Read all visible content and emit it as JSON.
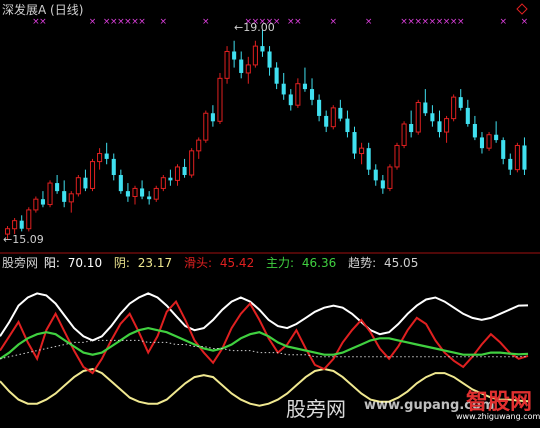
{
  "header": {
    "title": "深发展A (日线)",
    "max_label": "19.00",
    "min_label": "15.09"
  },
  "indicator": {
    "name": "股旁网",
    "yang_label": "阳:",
    "yang_value": "70.10",
    "yin_label": "阴:",
    "yin_value": "23.17",
    "slide_label": "滑头:",
    "slide_value": "45.42",
    "main_label": "主力:",
    "main_value": "46.36",
    "trend_label": "趋势:",
    "trend_value": "45.05"
  },
  "watermarks": {
    "site_cn": "股旁网",
    "site_en": "www.gupang.com",
    "brand": "智股网",
    "brand_url": "www.zhiguwang.com"
  },
  "colors": {
    "up": "#e02020",
    "down": "#40e0f0",
    "yang": "#ffffff",
    "yin": "#f0e890",
    "slide": "#e02020",
    "main": "#40d040",
    "trend": "#d0d0d0",
    "signal": "#e040e0",
    "divider": "#a01010"
  },
  "chart_data": [
    {
      "type": "candlestick",
      "title": "深发展A (日线)",
      "ylim": [
        15.09,
        19.0
      ],
      "annotations": [
        {
          "label": "19.00",
          "kind": "high"
        },
        {
          "label": "15.09",
          "kind": "low"
        }
      ],
      "signal_marker": "×",
      "candles": [
        [
          15.2,
          15.35,
          15.1,
          15.3
        ],
        [
          15.3,
          15.5,
          15.2,
          15.45
        ],
        [
          15.45,
          15.55,
          15.25,
          15.3
        ],
        [
          15.3,
          15.7,
          15.25,
          15.65
        ],
        [
          15.65,
          15.9,
          15.6,
          15.85
        ],
        [
          15.85,
          16.0,
          15.7,
          15.75
        ],
        [
          15.75,
          16.2,
          15.7,
          16.15
        ],
        [
          16.15,
          16.3,
          15.95,
          16.0
        ],
        [
          16.0,
          16.2,
          15.7,
          15.8
        ],
        [
          15.8,
          16.0,
          15.6,
          15.95
        ],
        [
          15.95,
          16.3,
          15.9,
          16.25
        ],
        [
          16.25,
          16.4,
          16.0,
          16.05
        ],
        [
          16.05,
          16.6,
          16.0,
          16.55
        ],
        [
          16.55,
          16.8,
          16.4,
          16.7
        ],
        [
          16.7,
          16.9,
          16.5,
          16.6
        ],
        [
          16.6,
          16.7,
          16.2,
          16.3
        ],
        [
          16.3,
          16.4,
          15.95,
          16.0
        ],
        [
          16.0,
          16.15,
          15.8,
          15.9
        ],
        [
          15.9,
          16.1,
          15.75,
          16.05
        ],
        [
          16.05,
          16.2,
          15.85,
          15.9
        ],
        [
          15.9,
          16.0,
          15.75,
          15.85
        ],
        [
          15.85,
          16.1,
          15.8,
          16.05
        ],
        [
          16.05,
          16.3,
          16.0,
          16.25
        ],
        [
          16.25,
          16.4,
          16.1,
          16.2
        ],
        [
          16.2,
          16.5,
          16.1,
          16.45
        ],
        [
          16.45,
          16.6,
          16.25,
          16.3
        ],
        [
          16.3,
          16.8,
          16.25,
          16.75
        ],
        [
          16.75,
          17.0,
          16.6,
          16.95
        ],
        [
          16.95,
          17.5,
          16.9,
          17.45
        ],
        [
          17.45,
          17.6,
          17.2,
          17.3
        ],
        [
          17.3,
          18.2,
          17.25,
          18.1
        ],
        [
          18.1,
          18.7,
          18.0,
          18.6
        ],
        [
          18.6,
          18.8,
          18.3,
          18.45
        ],
        [
          18.45,
          18.6,
          18.1,
          18.2
        ],
        [
          18.2,
          18.5,
          18.0,
          18.35
        ],
        [
          18.35,
          18.8,
          18.3,
          18.7
        ],
        [
          18.7,
          19.0,
          18.5,
          18.6
        ],
        [
          18.6,
          18.7,
          18.15,
          18.3
        ],
        [
          18.3,
          18.4,
          17.9,
          18.0
        ],
        [
          18.0,
          18.2,
          17.7,
          17.8
        ],
        [
          17.8,
          17.9,
          17.5,
          17.6
        ],
        [
          17.6,
          18.1,
          17.55,
          18.0
        ],
        [
          18.0,
          18.3,
          17.85,
          17.9
        ],
        [
          17.9,
          18.1,
          17.6,
          17.7
        ],
        [
          17.7,
          17.8,
          17.3,
          17.4
        ],
        [
          17.4,
          17.5,
          17.1,
          17.2
        ],
        [
          17.2,
          17.6,
          17.15,
          17.55
        ],
        [
          17.55,
          17.7,
          17.3,
          17.35
        ],
        [
          17.35,
          17.5,
          17.0,
          17.1
        ],
        [
          17.1,
          17.2,
          16.6,
          16.7
        ],
        [
          16.7,
          16.9,
          16.5,
          16.8
        ],
        [
          16.8,
          16.9,
          16.3,
          16.4
        ],
        [
          16.4,
          16.5,
          16.1,
          16.2
        ],
        [
          16.2,
          16.3,
          15.95,
          16.05
        ],
        [
          16.05,
          16.5,
          16.0,
          16.45
        ],
        [
          16.45,
          16.9,
          16.4,
          16.85
        ],
        [
          16.85,
          17.3,
          16.8,
          17.25
        ],
        [
          17.25,
          17.5,
          17.0,
          17.1
        ],
        [
          17.1,
          17.7,
          17.05,
          17.65
        ],
        [
          17.65,
          17.9,
          17.4,
          17.45
        ],
        [
          17.45,
          17.6,
          17.2,
          17.3
        ],
        [
          17.3,
          17.5,
          17.0,
          17.1
        ],
        [
          17.1,
          17.4,
          16.9,
          17.35
        ],
        [
          17.35,
          17.8,
          17.3,
          17.75
        ],
        [
          17.75,
          17.9,
          17.5,
          17.55
        ],
        [
          17.55,
          17.7,
          17.2,
          17.25
        ],
        [
          17.25,
          17.4,
          16.95,
          17.0
        ],
        [
          17.0,
          17.1,
          16.7,
          16.8
        ],
        [
          16.8,
          17.1,
          16.75,
          17.05
        ],
        [
          17.05,
          17.3,
          16.9,
          16.95
        ],
        [
          16.95,
          17.0,
          16.5,
          16.6
        ],
        [
          16.6,
          16.7,
          16.3,
          16.4
        ],
        [
          16.4,
          16.9,
          16.35,
          16.85
        ],
        [
          16.85,
          17.0,
          16.3,
          16.4
        ]
      ]
    },
    {
      "type": "line",
      "title": "股旁网",
      "series": [
        {
          "name": "阳",
          "color": "#ffffff",
          "values": [
            55,
            62,
            70,
            74,
            76,
            75,
            71,
            65,
            59,
            55,
            53,
            55,
            60,
            66,
            71,
            74,
            76,
            74,
            70,
            65,
            60,
            58,
            59,
            63,
            68,
            72,
            74,
            72,
            68,
            63,
            60,
            59,
            61,
            64,
            67,
            69,
            70,
            69,
            66,
            62,
            58,
            56,
            57,
            61,
            66,
            70,
            73,
            74,
            72,
            69,
            66,
            64,
            63,
            64,
            66,
            68,
            70,
            70.1
          ]
        },
        {
          "name": "阴",
          "color": "#f0e890",
          "values": [
            33,
            28,
            24,
            22,
            22,
            24,
            27,
            31,
            35,
            38,
            39,
            37,
            33,
            29,
            25,
            23,
            22,
            22,
            24,
            28,
            32,
            35,
            36,
            35,
            31,
            27,
            24,
            22,
            21,
            22,
            24,
            27,
            31,
            35,
            38,
            39,
            38,
            35,
            31,
            27,
            24,
            23,
            23,
            25,
            28,
            32,
            35,
            37,
            37,
            35,
            32,
            29,
            27,
            25,
            24,
            24,
            23.5,
            23.17
          ]
        },
        {
          "name": "滑头",
          "color": "#e02020",
          "values": [
            48,
            55,
            62,
            52,
            44,
            58,
            66,
            57,
            48,
            40,
            37,
            44,
            53,
            61,
            66,
            57,
            47,
            55,
            67,
            72,
            63,
            53,
            47,
            42,
            49,
            59,
            66,
            71,
            63,
            54,
            47,
            51,
            58,
            49,
            41,
            39,
            44,
            52,
            58,
            63,
            57,
            49,
            44,
            50,
            58,
            64,
            61,
            53,
            47,
            43,
            40,
            45,
            51,
            56,
            52,
            47,
            44,
            45.42
          ]
        },
        {
          "name": "主力",
          "color": "#40d040",
          "values": [
            44,
            47,
            51,
            54,
            56,
            57,
            56,
            53,
            50,
            47,
            46,
            47,
            50,
            53,
            56,
            58,
            59,
            58,
            57,
            55,
            53,
            51,
            49,
            48,
            49,
            51,
            54,
            56,
            57,
            55,
            52,
            50,
            49,
            48,
            47,
            46,
            46,
            47,
            49,
            51,
            53,
            54,
            54,
            53,
            52,
            51,
            50,
            49,
            48,
            47,
            46,
            46,
            46,
            47,
            47,
            46.5,
            46.2,
            46.36
          ]
        },
        {
          "name": "趋势",
          "color": "#d0d0d0",
          "values": [
            44,
            45,
            46,
            47,
            48,
            49,
            50,
            51,
            52,
            52,
            53,
            53,
            53,
            53,
            53,
            53,
            52,
            52,
            52,
            51,
            51,
            50,
            50,
            49,
            49,
            48,
            48,
            48,
            47,
            47,
            47,
            46,
            46,
            46,
            45,
            45,
            45,
            45,
            45,
            45,
            45,
            45,
            45,
            45,
            45,
            45,
            45,
            45,
            45,
            45,
            45,
            45,
            45,
            45,
            45,
            45,
            45,
            45.05
          ]
        }
      ]
    }
  ]
}
